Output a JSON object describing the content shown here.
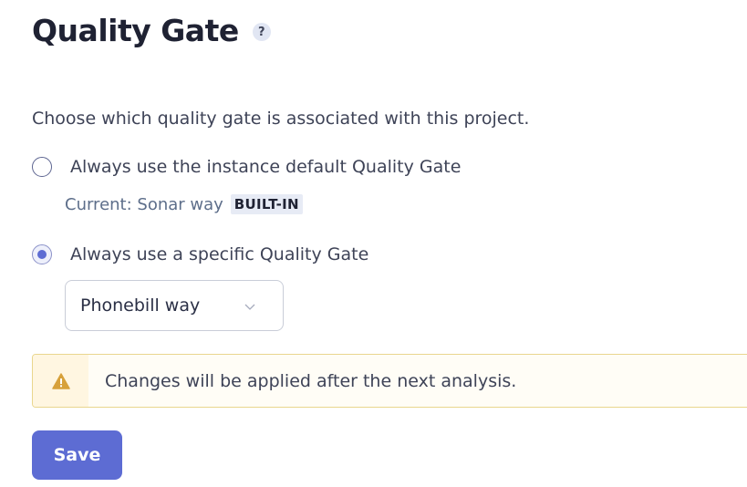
{
  "header": {
    "title": "Quality Gate",
    "help_symbol": "?"
  },
  "description": "Choose which quality gate is associated with this project.",
  "options": {
    "default": {
      "label": "Always use the instance default Quality Gate",
      "selected": false,
      "current_prefix": "Current: Sonar way",
      "badge": "BUILT-IN"
    },
    "specific": {
      "label": "Always use a specific Quality Gate",
      "selected": true,
      "selected_gate": "Phonebill way"
    }
  },
  "alert": {
    "icon": "warning-icon",
    "message": "Changes will be applied after the next analysis."
  },
  "actions": {
    "save_label": "Save"
  },
  "colors": {
    "accent": "#5d6cd3",
    "warning": "#d7a13b",
    "alert_border": "#ead68e"
  }
}
